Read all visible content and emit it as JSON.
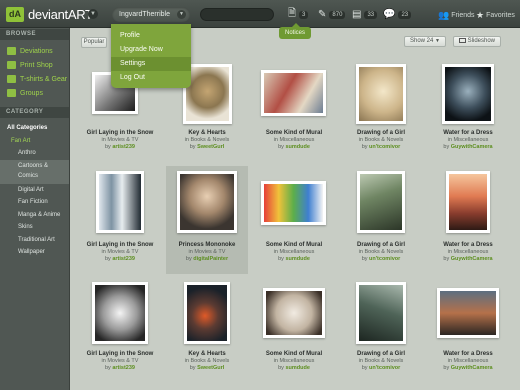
{
  "topbar": {
    "logo_text": "deviantART",
    "username": "IngvardTherrible",
    "search_placeholder": "",
    "notes_count": "3",
    "deviations_count": "870",
    "messages_count": "33",
    "comments_count": "23",
    "friends_label": "Friends",
    "favorites_label": "Favorites",
    "notices_tooltip": "Notices"
  },
  "user_menu": {
    "items": [
      "Profile",
      "Upgrade Now",
      "Settings",
      "Log Out"
    ]
  },
  "sidebar": {
    "browse_heading": "BROWSE",
    "browse_items": [
      "Deviations",
      "Print Shop",
      "T-shirts & Gear",
      "Groups"
    ],
    "category_heading": "CATEGORY",
    "all_label": "All Categories",
    "fan_art_label": "Fan Art",
    "categories": [
      "Anthro",
      "Cartoons & Comics",
      "Digital Art",
      "Fan Fiction",
      "Manga & Anime",
      "Skins",
      "Traditional Art",
      "Wallpaper"
    ]
  },
  "toolbar": {
    "popular_label": "Popular",
    "show_label": "Show 24",
    "slideshow_label": "Slideshow"
  },
  "gallery": [
    {
      "title": "Girl Laying in the Snow",
      "in": "in Movies & TV",
      "by": "artist239"
    },
    {
      "title": "Key & Hearts",
      "in": "in Books & Novels",
      "by": "SweetGurl"
    },
    {
      "title": "Some Kind of Mural",
      "in": "in Miscellaneous",
      "by": "sumdude"
    },
    {
      "title": "Drawing of a Girl",
      "in": "in Books & Novels",
      "by": "un'tcomivor"
    },
    {
      "title": "Water for a Dress",
      "in": "in Miscellaneous",
      "by": "GuywithCamera"
    },
    {
      "title": "Girl Laying in the Snow",
      "in": "in Movies & TV",
      "by": "artist239"
    },
    {
      "title": "Princess Mononoke",
      "in": "in Movies & TV",
      "by": "digitalPainter"
    },
    {
      "title": "Some Kind of Mural",
      "in": "in Miscellaneous",
      "by": "sumdude"
    },
    {
      "title": "Drawing of a Girl",
      "in": "in Books & Novels",
      "by": "un'tcomivor"
    },
    {
      "title": "Water for a Dress",
      "in": "in Miscellaneous",
      "by": "GuywithCamera"
    },
    {
      "title": "Girl Laying in the Snow",
      "in": "in Movies & TV",
      "by": "artist239"
    },
    {
      "title": "Key & Hearts",
      "in": "in Books & Novels",
      "by": "SweetGurl"
    },
    {
      "title": "Some Kind of Mural",
      "in": "in Miscellaneous",
      "by": "sumdude"
    },
    {
      "title": "Drawing of a Girl",
      "in": "in Books & Novels",
      "by": "un'tcomivor"
    },
    {
      "title": "Water for a Dress",
      "in": "in Miscellaneous",
      "by": "GuywithCamera"
    }
  ],
  "by_prefix": "by",
  "colors": {
    "accent": "#8fc238",
    "topbar": "#444b47",
    "sidebar": "#505753",
    "background": "#c8cdc5"
  }
}
